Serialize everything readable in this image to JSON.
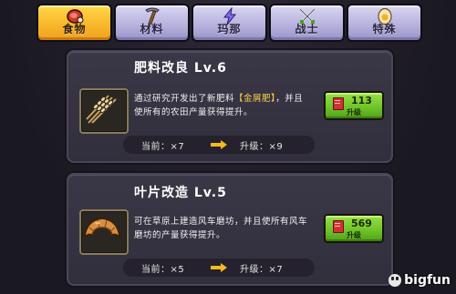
{
  "tabs": [
    {
      "label": "食物",
      "icon": "meat-icon",
      "active": true
    },
    {
      "label": "材料",
      "icon": "pickaxe-icon",
      "active": false
    },
    {
      "label": "玛那",
      "icon": "lightning-icon",
      "active": false
    },
    {
      "label": "战士",
      "icon": "crossed-swords-icon",
      "active": false
    },
    {
      "label": "特殊",
      "icon": "egg-icon",
      "active": false
    }
  ],
  "cards": [
    {
      "title": "肥料改良 Lv.6",
      "icon": "wheat-icon",
      "desc_before": "通过研究开发出了新肥料",
      "desc_highlight": "【金屑肥】",
      "desc_after": "，并且使所有的农田产量获得提升。",
      "cost": "113",
      "button_label": "升级",
      "current_label": "当前：×7",
      "next_label": "升级：×9"
    },
    {
      "title": "叶片改造 Lv.5",
      "icon": "croissant-icon",
      "desc_before": "可在草原上建造风车磨坊，并且使所有风车磨坊的产量获得提升。",
      "desc_highlight": "",
      "desc_after": "",
      "cost": "569",
      "button_label": "升级",
      "current_label": "当前：×5",
      "next_label": "升级：×7"
    }
  ],
  "watermark": "bigfun",
  "colors": {
    "tab_active": "#f8b82a",
    "tab_inactive": "#b8b3de",
    "upgrade_button": "#6cc228",
    "highlight": "#ffd24a",
    "arrow": "#f8b820"
  }
}
